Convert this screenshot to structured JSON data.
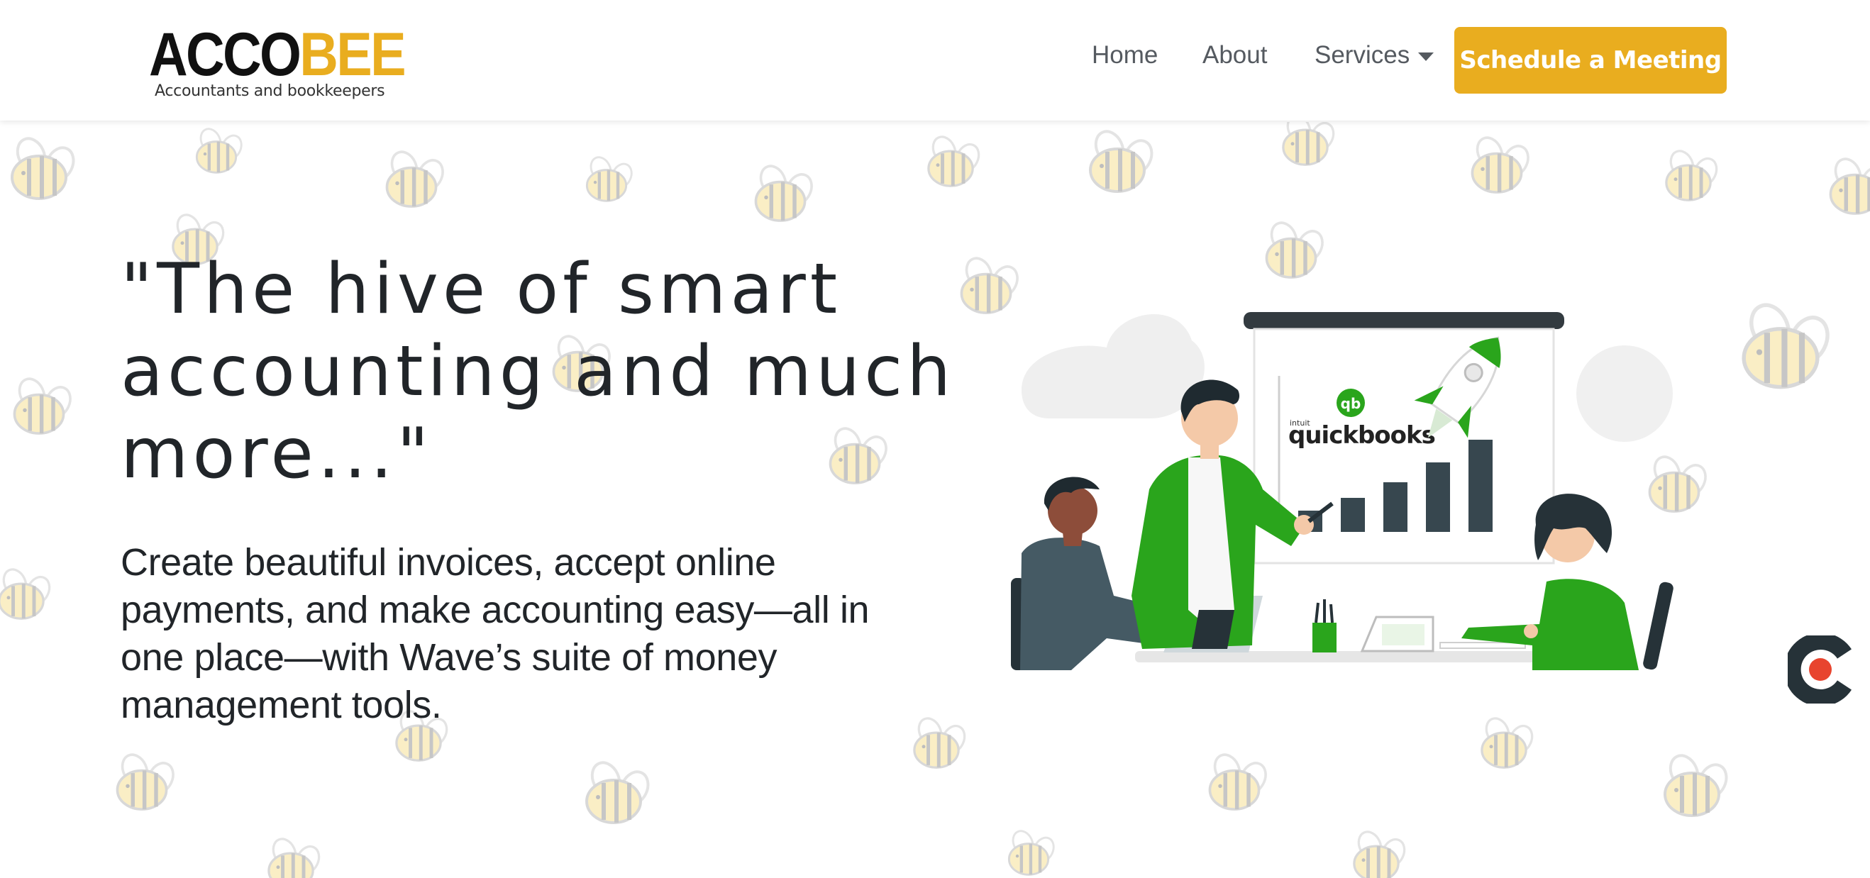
{
  "header": {
    "logo": {
      "part1": "ACCO",
      "part2": "BEE",
      "tagline": "Accountants and bookkeepers"
    },
    "nav": [
      {
        "label": "Home"
      },
      {
        "label": "About"
      },
      {
        "label": "Services"
      }
    ],
    "cta_label": "Schedule a Meeting"
  },
  "hero": {
    "title": "\"The hive of smart accounting and much more...\"",
    "description": "Create beautiful invoices, accept online payments, and make accounting easy—all in one place—with Wave’s suite of money management tools."
  },
  "illustration": {
    "brand_small": "intuit",
    "brand": "quickbooks",
    "brand_badge": "qb"
  },
  "colors": {
    "accent": "#e9ad1f",
    "text": "#212529",
    "nav_text": "#555a60",
    "illustration_green": "#2aa51c",
    "illustration_dark": "#37474f",
    "widget_red": "#e8442e"
  },
  "icons": [
    "bee-pattern-icon",
    "chevron-down-icon",
    "chat-widget-icon"
  ]
}
